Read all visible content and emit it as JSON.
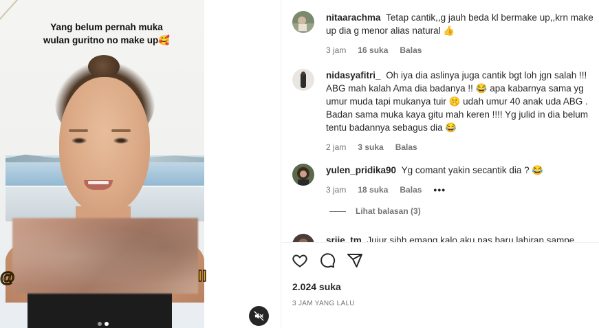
{
  "media": {
    "caption_line1": "Yang belum pernah muka",
    "caption_line2": "wulan guritno no make up🥰",
    "watermark_left": "@",
    "watermark_right": "ll"
  },
  "comments": [
    {
      "username": "nitaarachma",
      "text": "Tetap cantik,,g jauh beda kl bermake up,,krn make up dia g menor alias natural 👍",
      "time": "3 jam",
      "likes": "16 suka",
      "reply": "Balas"
    },
    {
      "username": "nidasyafitri_",
      "text": "Oh iya dia aslinya juga cantik bgt loh jgn salah !!! ABG mah kalah Ama dia badanya !! 😂 apa kabarnya sama yg umur muda tapi mukanya tuir 🤫 udah umur 40 anak uda ABG . Badan sama muka kaya gitu mah keren !!!! Yg julid in dia belum tentu badannya sebagus dia 😂",
      "time": "2 jam",
      "likes": "3 suka",
      "reply": "Balas"
    },
    {
      "username": "yulen_pridika90",
      "text": "Yg comant yakin secantik dia ? 😂",
      "time": "3 jam",
      "likes": "18 suka",
      "reply": "Balas",
      "more": "•••",
      "view_replies": "Lihat balasan (3)"
    },
    {
      "username": "sriie_tm",
      "text": "Jujur sihh emang kalo aku pas baru lahiran sampe"
    }
  ],
  "footer": {
    "likes": "2.024 suka",
    "timestamp": "3 JAM YANG LALU"
  }
}
